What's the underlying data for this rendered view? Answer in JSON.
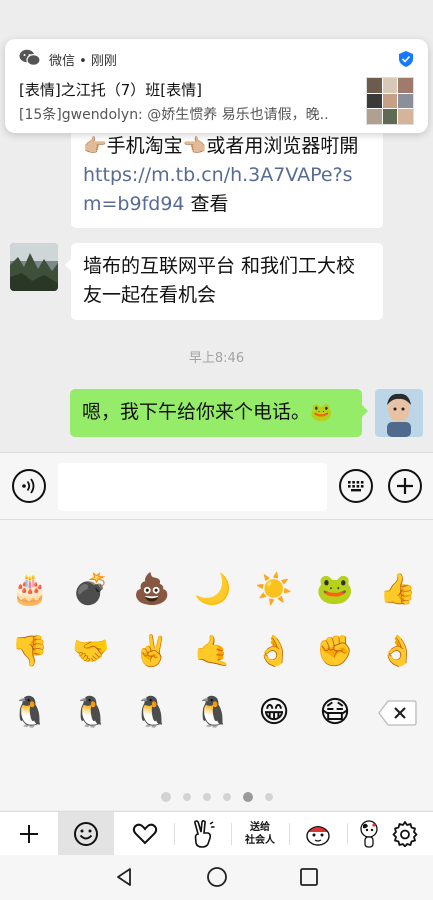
{
  "notification": {
    "app": "微信 • 刚刚",
    "title": "[表情]之江托（7）班[表情]",
    "body": "[15条]gwendolyn: @娇生惯养 易乐也请假，晚.."
  },
  "messages": [
    {
      "line1": "👉🏼手机淘宝👈🏼或者用浏览器咑開",
      "link": "https://m.tb.cn/h.3A7VAPe?sm=b9fd94",
      "suffix": " 查看"
    },
    {
      "text": "墙布的互联网平台 和我们工大校友一起在看机会"
    },
    {
      "text": "嗯，我下午给你来个电话。",
      "emoji": "🐸"
    }
  ],
  "time_label": "早上8:46",
  "input": {
    "value": "",
    "placeholder": ""
  },
  "emoji_grid": [
    [
      "🎂",
      "💣",
      "💩",
      "🌙",
      "☀️",
      "🐸",
      "👍"
    ],
    [
      "👎",
      "🤝",
      "✌️",
      "🤙",
      "👌",
      "✊",
      "👌"
    ],
    [
      "🐧",
      "🐧",
      "🐧",
      "🐧",
      "😁",
      "😷",
      "backspace"
    ]
  ],
  "page_dots": {
    "count": 6,
    "active_index": 4
  },
  "toolbar": {
    "items": [
      "add",
      "emoji",
      "favorites",
      "gesture-sticker",
      "sticker-pack",
      "penguin-sticker",
      "cow-sticker",
      "settings"
    ],
    "sticker_pack_label": "送给\n社会人"
  },
  "nav": {
    "items": [
      "back",
      "home",
      "recents"
    ]
  },
  "colors": {
    "chat_bg": "#ededed",
    "self_bubble": "#95ec69",
    "link": "#576b95",
    "verified_badge": "#1677ff"
  }
}
